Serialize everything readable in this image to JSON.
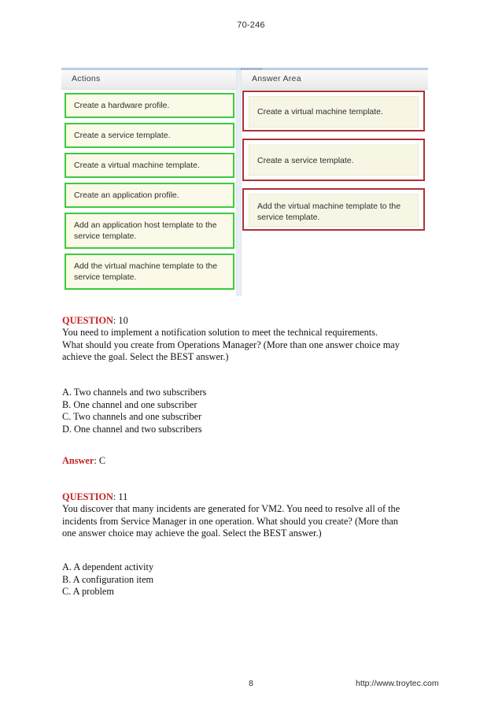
{
  "page": {
    "header_title": "70-246",
    "footer_page_number": "8",
    "footer_url": "http://www.troytec.com"
  },
  "colors": {
    "action_tile_border": "#3ccb3c",
    "action_tile_fill": "#fbf9e7",
    "answer_slot_border": "#ad3333",
    "answer_slot_fill": "#f7f5e4",
    "label_red": "#c32222",
    "header_band_top_rule": "#b9cfe4"
  },
  "exhibit": {
    "columns": {
      "actions_header": "Actions",
      "answer_header": "Answer Area"
    },
    "actions": [
      {
        "label": "Create a hardware profile."
      },
      {
        "label": "Create a service template."
      },
      {
        "label": "Create a virtual machine template."
      },
      {
        "label": "Create an application profile."
      },
      {
        "label": "Add an application host template to the service template."
      },
      {
        "label": "Add the virtual machine template to the service template."
      }
    ],
    "answer_area": [
      {
        "label": "Create a virtual machine template."
      },
      {
        "label": "Create a service template."
      },
      {
        "label": "Add the virtual machine template to the service template."
      }
    ]
  },
  "questions": [
    {
      "label": "QUESTION",
      "separator": ": ",
      "number": "10",
      "stem_lines": [
        "You need to implement a notification solution to meet the technical requirements.",
        "What should you create from Operations Manager? (More than one answer choice may",
        "achieve the goal. Select the BEST answer.)"
      ],
      "options": [
        "A. Two channels and two subscribers",
        "B. One channel and one subscriber",
        "C. Two channels and one subscriber",
        "D. One channel and two subscribers"
      ]
    },
    {
      "label": "QUESTION",
      "separator": ": ",
      "number": "11",
      "stem_lines": [
        "You discover that many incidents are generated for VM2. You need to resolve all of the",
        "incidents from Service Manager in one operation. What should you create? (More than",
        "one answer choice may achieve the goal. Select the BEST answer.)"
      ],
      "options": [
        "A. A dependent activity",
        "B. A configuration item",
        "C. A problem"
      ]
    }
  ],
  "answer": {
    "label": "Answer",
    "separator": ": ",
    "value": "C"
  }
}
